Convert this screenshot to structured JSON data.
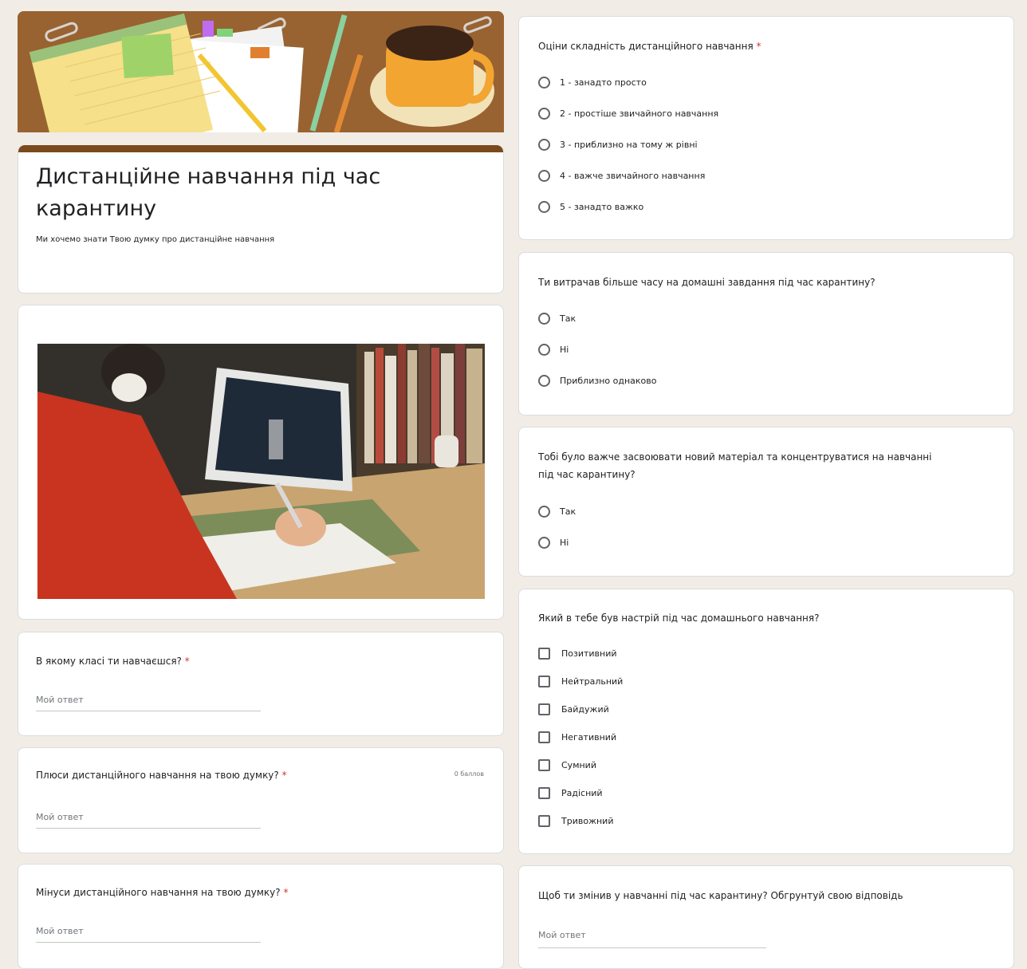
{
  "form": {
    "title_line1": "Дистанційне навчання під час",
    "title_line2": "карантину",
    "description": "Ми хочемо знати Твою думку про дистанційне навчання",
    "accent_color": "#7b4a1c",
    "required_mark": "*"
  },
  "questions_left": [
    {
      "label": "В якому класі ти навчаєшся?",
      "required": true,
      "placeholder": "Мой ответ"
    },
    {
      "label": "Плюси дистанційного навчання на твою думку?",
      "required": true,
      "placeholder": "Мой ответ",
      "points": "0 баллов"
    },
    {
      "label": "Мінуси дистанційного навчання на твою думку?",
      "required": true,
      "placeholder": "Мой ответ"
    }
  ],
  "q_difficulty": {
    "label": "Оціни складність дистанційного навчання",
    "required": true,
    "options": [
      "1 - занадто просто",
      "2 - простіше звичайного навчання",
      "3 - приблизно на тому ж рівні",
      "4 - важче звичайного навчання",
      "5 - занадто важко"
    ]
  },
  "q_homework": {
    "label": "Ти витрачав більше часу на домашні завдання під час карантину?",
    "options": [
      "Так",
      "Ні",
      "Приблизно однаково"
    ]
  },
  "q_concentration": {
    "label_line1": "Тобі було важче засвоювати новий матеріал та концентруватися на навчанні",
    "label_line2": "під час карантину?",
    "options": [
      "Так",
      "Ні"
    ]
  },
  "q_mood": {
    "label": "Який в тебе був настрій під час домашнього навчання?",
    "options": [
      "Позитивний",
      "Нейтральний",
      "Байдужий",
      "Негативний",
      "Сумний",
      "Радісний",
      "Тривожний"
    ]
  },
  "q_change": {
    "label": "Щоб ти змінив у навчанні під час карантину? Обгрунтуй свою відповідь",
    "placeholder": "Мой ответ"
  }
}
